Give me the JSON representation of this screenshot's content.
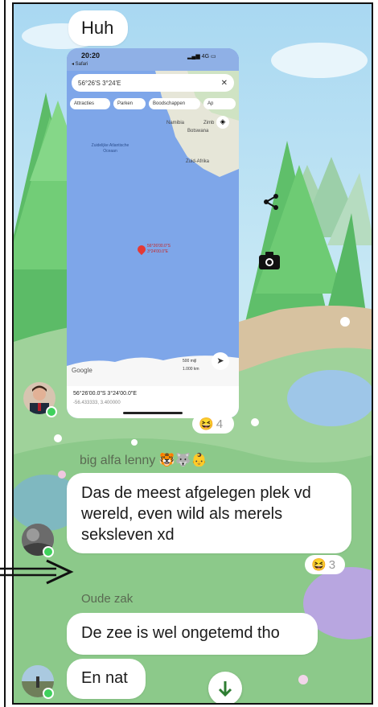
{
  "messages": {
    "m0": {
      "text": "Huh"
    },
    "map_reaction": {
      "emoji": "😆",
      "count": "4"
    },
    "m1": {
      "sender": "big alfa lenny",
      "sender_emojis": "🐯🐺👶",
      "lines": [
        "Das de meest afgelegen plek vd",
        "wereld, even wild als merels",
        "seksleven xd"
      ]
    },
    "m1_reaction": {
      "emoji": "😆",
      "count": "3"
    },
    "m2": {
      "sender": "Oude zak",
      "text": "De zee is wel ongetemd tho"
    },
    "m3": {
      "text": "En nat"
    }
  },
  "map_screenshot": {
    "time": "20:20",
    "back_label": "◂ Safari",
    "search_text": "56°26'S 3°24'E",
    "chips": [
      "Attracties",
      "Parken",
      "Boodschappen",
      "Ap"
    ],
    "labels": {
      "namibia": "Namibia",
      "botswana": "Botswana",
      "zimb": "Zimb",
      "south_africa": "Zuid-Afrika",
      "ocean": "Zuidelijke Atlantische Oceaan",
      "pin": "56°26'00.0\"S 3°24'00.0\"E",
      "google": "Google",
      "scale1": "500 mijl",
      "scale2": "1.000 km"
    },
    "coords": "56°26'00.0\"S 3°24'00.0\"E",
    "coords_decimal": "-56.433333, 3.400000"
  },
  "colors": {
    "online": "#3fd15c",
    "bubble": "#ffffff",
    "pin": "#e53935"
  },
  "icons": [
    "share-icon",
    "camera-icon",
    "scroll-down-icon",
    "navigate-icon",
    "close-icon",
    "layers-icon"
  ]
}
